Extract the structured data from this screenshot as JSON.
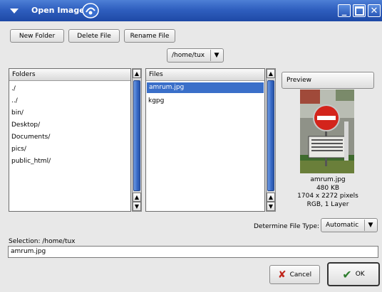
{
  "window": {
    "title": "Open Image"
  },
  "toolbar": {
    "new_folder": "New Folder",
    "delete_file": "Delete File",
    "rename_file": "Rename File",
    "path": "/home/tux"
  },
  "folders": {
    "header": "Folders",
    "items": [
      "./",
      "../",
      "bin/",
      "Desktop/",
      "Documents/",
      "pics/",
      "public_html/"
    ]
  },
  "files": {
    "header": "Files",
    "items": [
      "amrum.jpg",
      "kgpg"
    ],
    "selected": "amrum.jpg"
  },
  "preview": {
    "button": "Preview",
    "filename": "amrum.jpg",
    "size": "480 KB",
    "dimensions": "1704 x 2272 pixels",
    "mode": "RGB, 1 Layer"
  },
  "filetype": {
    "label": "Determine File Type:",
    "value": "Automatic"
  },
  "selection": {
    "label": "Selection: /home/tux",
    "value": "amrum.jpg"
  },
  "actions": {
    "cancel": "Cancel",
    "ok": "OK"
  }
}
